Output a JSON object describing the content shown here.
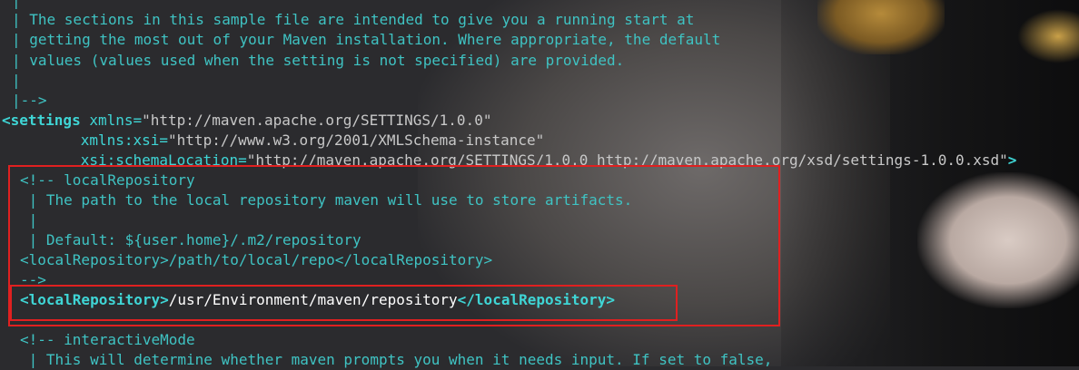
{
  "lines": {
    "l0": "|",
    "l1": "| The sections in this sample file are intended to give you a running start at",
    "l2": "| getting the most out of your Maven installation. Where appropriate, the default",
    "l3": "| values (values used when the setting is not specified) are provided.",
    "l4": "|",
    "l5": "|-->",
    "settings_tag": "<settings",
    "xmlns_attr": " xmlns=",
    "xmlns_val": "\"http://maven.apache.org/SETTINGS/1.0.0\"",
    "xsi_indent": "        ",
    "xsi_attr": " xmlns:xsi=",
    "xsi_val": "\"http://www.w3.org/2001/XMLSchema-instance\"",
    "schema_attr": " xsi:schemaLocation=",
    "schema_val": "\"http://maven.apache.org/SETTINGS/1.0.0 http://maven.apache.org/xsd/settings-1.0.0.xsd\"",
    "schema_close": ">",
    "c1": "<!-- localRepository",
    "c2": " | The path to the local repository maven will use to store artifacts.",
    "c3": " |",
    "c4": " | Default: ${user.home}/.m2/repository",
    "c5": "<localRepository>/path/to/local/repo</localRepository>",
    "c6": "-->",
    "lr_open": "<localRepository>",
    "lr_value": "/usr/Environment/maven/repository",
    "lr_close": "</localRepository>",
    "c7": "<!-- interactiveMode",
    "c8": " | This will determine whether maven prompts you when it needs input. If set to false,"
  }
}
